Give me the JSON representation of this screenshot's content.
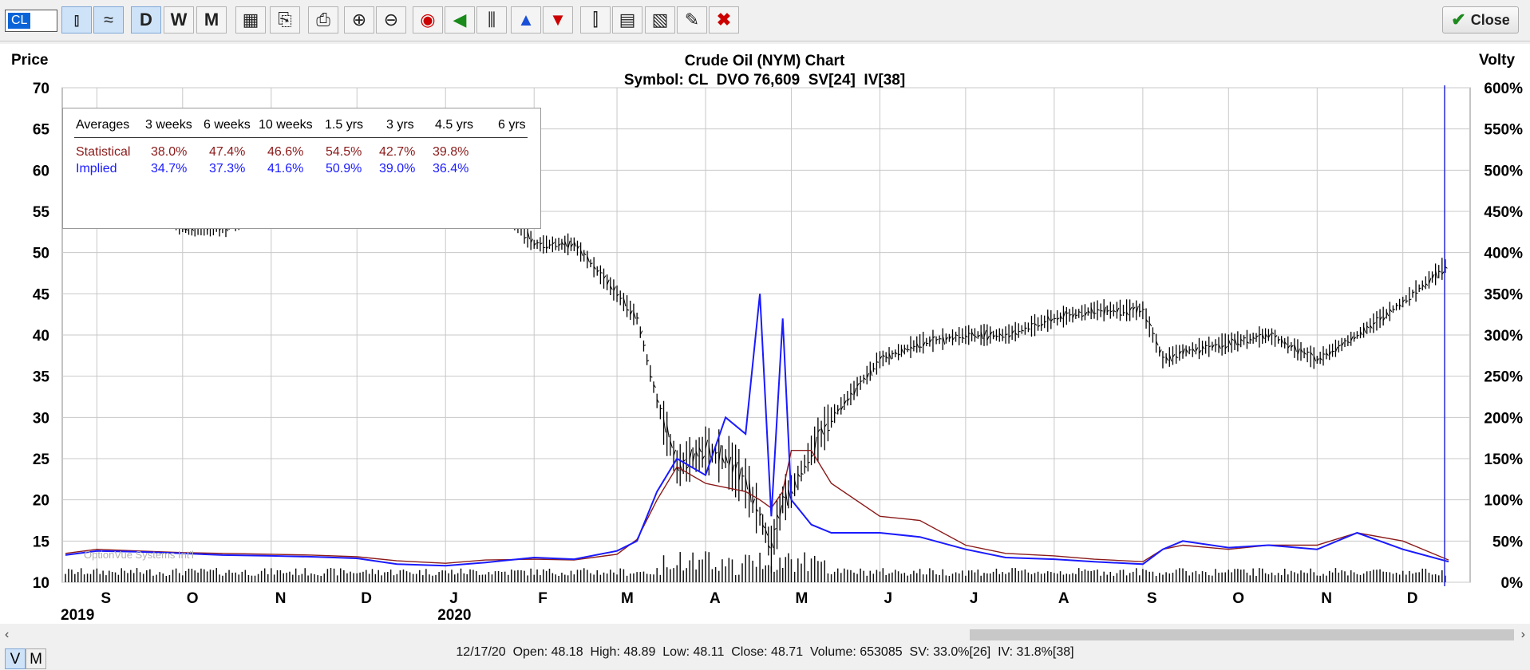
{
  "toolbar": {
    "symbol": "CL",
    "period_daily": "D",
    "period_weekly": "W",
    "period_monthly": "M",
    "close_label": "Close"
  },
  "header": {
    "title": "Crude Oil (NYM) Chart",
    "subtitle": "Symbol: CL  DVO 76,609  SV[24]  IV[38]",
    "left_axis_label": "Price",
    "right_axis_label": "Volty"
  },
  "averages": {
    "headers": [
      "Averages",
      "3 weeks",
      "6 weeks",
      "10 weeks",
      "1.5 yrs",
      "3 yrs",
      "4.5 yrs",
      "6 yrs"
    ],
    "statistical": {
      "label": "Statistical",
      "values": [
        "38.0%",
        "47.4%",
        "46.6%",
        "54.5%",
        "42.7%",
        "39.8%"
      ]
    },
    "implied": {
      "label": "Implied",
      "values": [
        "34.7%",
        "37.3%",
        "41.6%",
        "50.9%",
        "39.0%",
        "36.4%"
      ]
    }
  },
  "watermark": "OptionVue Systems Int'l",
  "vm_toggle": {
    "v": "V",
    "m": "M"
  },
  "status_bar": "12/17/20  Open: 48.18  High: 48.89  Low: 48.11  Close: 48.71  Volume: 653085  SV: 33.0%[26]  IV: 31.8%[38]",
  "colors": {
    "price": "#000000",
    "statistical": "#8b1a1a",
    "implied": "#1a1aff",
    "grid": "#c8c8c8",
    "cursor": "#2a2ad8"
  },
  "chart_data": {
    "type": "line",
    "title": "Crude Oil (NYM) Chart",
    "price_axis": {
      "label": "Price",
      "ticks": [
        10,
        15,
        20,
        25,
        30,
        35,
        40,
        45,
        50,
        55,
        60,
        65,
        70
      ],
      "range": [
        10,
        70
      ]
    },
    "volatility_axis": {
      "label": "Volty",
      "ticks": [
        "0%",
        "50%",
        "100%",
        "150%",
        "200%",
        "250%",
        "300%",
        "350%",
        "400%",
        "450%",
        "500%",
        "550%",
        "600%"
      ],
      "range": [
        0,
        600
      ]
    },
    "month_labels": [
      "S",
      "O",
      "N",
      "D",
      "J",
      "F",
      "M",
      "A",
      "M",
      "J",
      "J",
      "A",
      "S",
      "O",
      "N",
      "D"
    ],
    "year_labels": [
      "2019",
      "2020"
    ],
    "x": [
      "2019-08-21",
      "2019-09-01",
      "2019-09-15",
      "2019-10-01",
      "2019-10-15",
      "2019-11-01",
      "2019-11-15",
      "2019-12-01",
      "2019-12-15",
      "2020-01-01",
      "2020-01-15",
      "2020-02-01",
      "2020-02-15",
      "2020-03-01",
      "2020-03-08",
      "2020-03-15",
      "2020-03-22",
      "2020-04-01",
      "2020-04-08",
      "2020-04-15",
      "2020-04-20",
      "2020-04-24",
      "2020-04-28",
      "2020-05-01",
      "2020-05-08",
      "2020-05-15",
      "2020-06-01",
      "2020-06-15",
      "2020-07-01",
      "2020-07-15",
      "2020-08-01",
      "2020-08-15",
      "2020-09-01",
      "2020-09-08",
      "2020-09-15",
      "2020-10-01",
      "2020-10-15",
      "2020-11-01",
      "2020-11-15",
      "2020-12-01",
      "2020-12-17"
    ],
    "series": [
      {
        "name": "Price",
        "axis": "price",
        "values": [
          56,
          55,
          57,
          53,
          53,
          56,
          57,
          58,
          61,
          62,
          58,
          51,
          51,
          45,
          42,
          32,
          24,
          26,
          25,
          22,
          18,
          14,
          20,
          21,
          26,
          30,
          37,
          39,
          40,
          40,
          42,
          43,
          43,
          37,
          38,
          39,
          40,
          37,
          40,
          44,
          48.7
        ]
      },
      {
        "name": "Statistical",
        "axis": "volatility",
        "values": [
          35,
          40,
          38,
          36,
          35,
          34,
          33,
          31,
          26,
          23,
          27,
          28,
          27,
          34,
          52,
          100,
          140,
          120,
          115,
          110,
          100,
          90,
          110,
          160,
          160,
          120,
          80,
          75,
          45,
          35,
          32,
          28,
          25,
          40,
          45,
          40,
          45,
          45,
          60,
          50,
          27
        ]
      },
      {
        "name": "Implied",
        "axis": "volatility",
        "values": [
          33,
          38,
          37,
          35,
          33,
          32,
          31,
          29,
          22,
          20,
          24,
          30,
          28,
          38,
          50,
          110,
          150,
          130,
          200,
          180,
          350,
          80,
          320,
          100,
          70,
          60,
          60,
          55,
          40,
          30,
          28,
          25,
          22,
          40,
          50,
          42,
          45,
          40,
          60,
          40,
          25
        ]
      }
    ],
    "grid": true
  }
}
